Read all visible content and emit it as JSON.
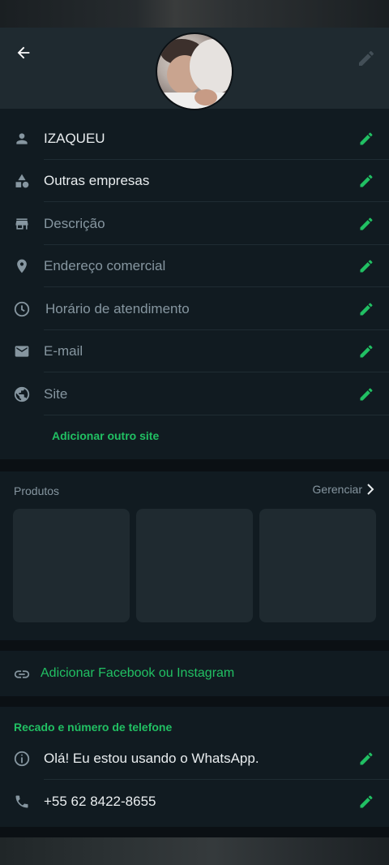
{
  "header": {
    "back_icon": "arrow-left-icon",
    "edit_icon": "pencil-icon"
  },
  "profile": {
    "avatar": "profile-photo"
  },
  "info_rows": [
    {
      "icon": "person-icon",
      "label": "IZAQUEU",
      "filled": true
    },
    {
      "icon": "category-icon",
      "label": "Outras empresas",
      "filled": true
    },
    {
      "icon": "store-icon",
      "label": "Descrição",
      "filled": false
    },
    {
      "icon": "location-pin-icon",
      "label": "Endereço comercial",
      "filled": false
    },
    {
      "icon": "clock-icon",
      "label": "Horário de atendimento",
      "filled": false
    },
    {
      "icon": "mail-icon",
      "label": "E-mail",
      "filled": false
    },
    {
      "icon": "globe-icon",
      "label": "Site",
      "filled": false
    }
  ],
  "add_site_label": "Adicionar outro site",
  "products": {
    "title": "Produtos",
    "manage_label": "Gerenciar"
  },
  "social": {
    "label": "Adicionar Facebook ou Instagram"
  },
  "about": {
    "title": "Recado e número de telefone",
    "status": "Olá! Eu estou usando o WhatsApp.",
    "phone": "+55 62 8422-8655"
  },
  "colors": {
    "accent": "#21c063",
    "background": "#0b1014",
    "card": "#111b21",
    "muted": "#8696a0"
  }
}
